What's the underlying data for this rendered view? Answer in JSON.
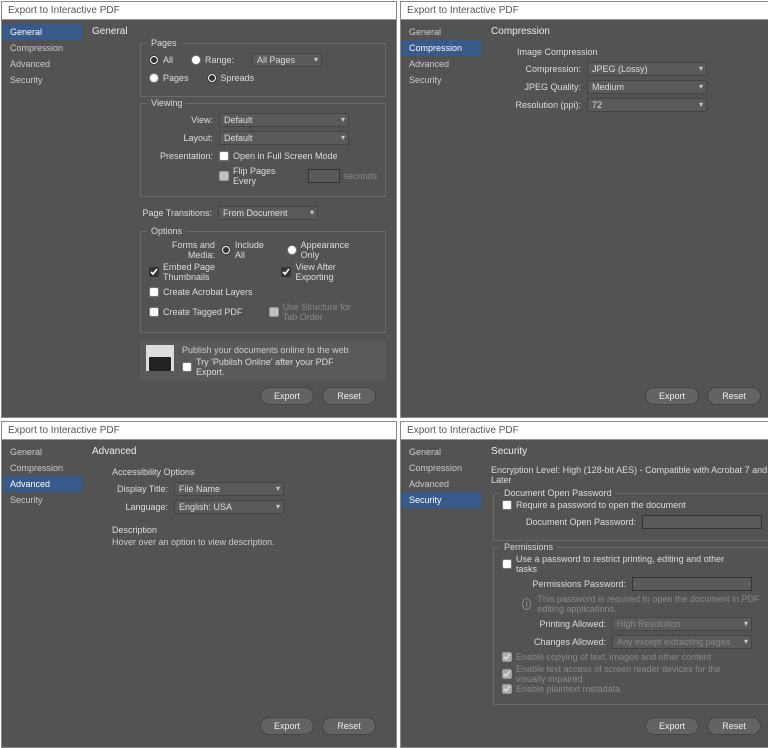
{
  "shared": {
    "windowTitle": "Export to Interactive PDF",
    "exportBtn": "Export",
    "resetBtn": "Reset",
    "tabs": [
      "General",
      "Compression",
      "Advanced",
      "Security"
    ]
  },
  "general": {
    "heading": "General",
    "pages": {
      "legend": "Pages",
      "all": "All",
      "range": "Range:",
      "rangeValue": "All Pages",
      "pagesRadio": "Pages",
      "spreadsRadio": "Spreads"
    },
    "viewing": {
      "legend": "Viewing",
      "viewLbl": "View:",
      "viewVal": "Default",
      "layoutLbl": "Layout:",
      "layoutVal": "Default",
      "presentationLbl": "Presentation:",
      "openFullScreen": "Open in Full Screen Mode",
      "flipLbl": "Flip Pages Every",
      "flipUnit": "seconds",
      "pageTransLbl": "Page Transitions:",
      "pageTransVal": "From Document"
    },
    "options": {
      "legend": "Options",
      "formsLbl": "Forms and Media:",
      "includeAll": "Include All",
      "appearanceOnly": "Appearance Only",
      "embedThumbs": "Embed Page Thumbnails",
      "viewAfter": "View After Exporting",
      "acroLayers": "Create Acrobat Layers",
      "taggedPdf": "Create Tagged PDF",
      "structureTab": "Use Structure for Tab Order"
    },
    "publish": {
      "line1": "Publish your documents online to the web",
      "line2": "Try 'Publish Online' after your PDF Export."
    }
  },
  "compression": {
    "heading": "Compression",
    "legend": "Image Compression",
    "compressionLbl": "Compression:",
    "compressionVal": "JPEG (Lossy)",
    "qualityLbl": "JPEG Quality:",
    "qualityVal": "Medium",
    "resLbl": "Resolution (ppi):",
    "resVal": "72"
  },
  "advanced": {
    "heading": "Advanced",
    "legend": "Accessibility Options",
    "displayTitleLbl": "Display Title:",
    "displayTitleVal": "File Name",
    "languageLbl": "Language:",
    "languageVal": "English: USA",
    "descHead": "Description",
    "descBody": "Hover over an option to view description."
  },
  "security": {
    "heading": "Security",
    "encLine": "Encryption Level: High (128-bit AES) - Compatible with Acrobat 7 and Later",
    "docOpen": {
      "legend": "Document Open Password",
      "require": "Require a password to open the document",
      "pwdLbl": "Document Open Password:"
    },
    "perm": {
      "legend": "Permissions",
      "usePwd": "Use a password to restrict printing, editing and other tasks",
      "permPwdLbl": "Permissions Password:",
      "info": "This password is required to open the document in PDF editing applications.",
      "printLbl": "Printing Allowed:",
      "printVal": "High Resolution",
      "changesLbl": "Changes Allowed:",
      "changesVal": "Any except extracting pages",
      "enableCopy": "Enable copying of text, images and other content",
      "enableScreen": "Enable text access of screen reader devices for the visually impaired",
      "enablePlain": "Enable plaintext metadata"
    }
  }
}
